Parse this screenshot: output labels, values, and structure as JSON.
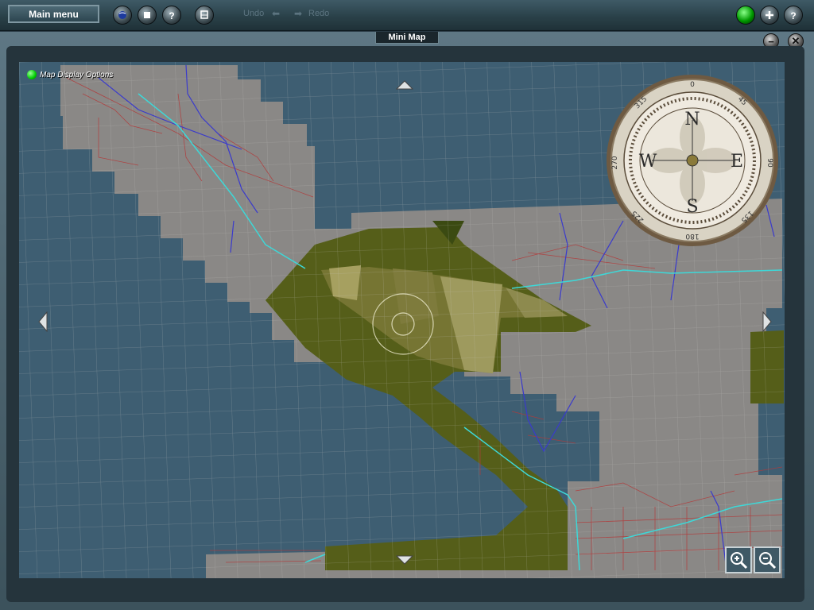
{
  "toolbar": {
    "main_menu_label": "Main menu",
    "undo_label": "Undo",
    "redo_label": "Redo",
    "icons": [
      "globe-icon",
      "stop-icon",
      "question-mark-icon",
      "train-icon",
      "status-light-icon",
      "plus-icon",
      "help-icon"
    ]
  },
  "window": {
    "title": "Mini Map",
    "minimize_icon": "minus-icon",
    "close_icon": "close-icon"
  },
  "map": {
    "display_options_label": "Map Display Options",
    "compass": {
      "letters": {
        "n": "N",
        "e": "E",
        "s": "S",
        "w": "W"
      },
      "degrees": [
        "0",
        "45",
        "90",
        "135",
        "180",
        "225",
        "270",
        "315"
      ]
    },
    "zoom_in_icon": "zoom-in-icon",
    "zoom_out_icon": "zoom-out-icon",
    "colors": {
      "water": "#3e5e72",
      "tile": "#8a8886",
      "forest": "#555e19",
      "field": "#9e9a5e",
      "road": "#b23a3a",
      "river": "#3a3acc",
      "rail": "#3dd8d8"
    }
  }
}
